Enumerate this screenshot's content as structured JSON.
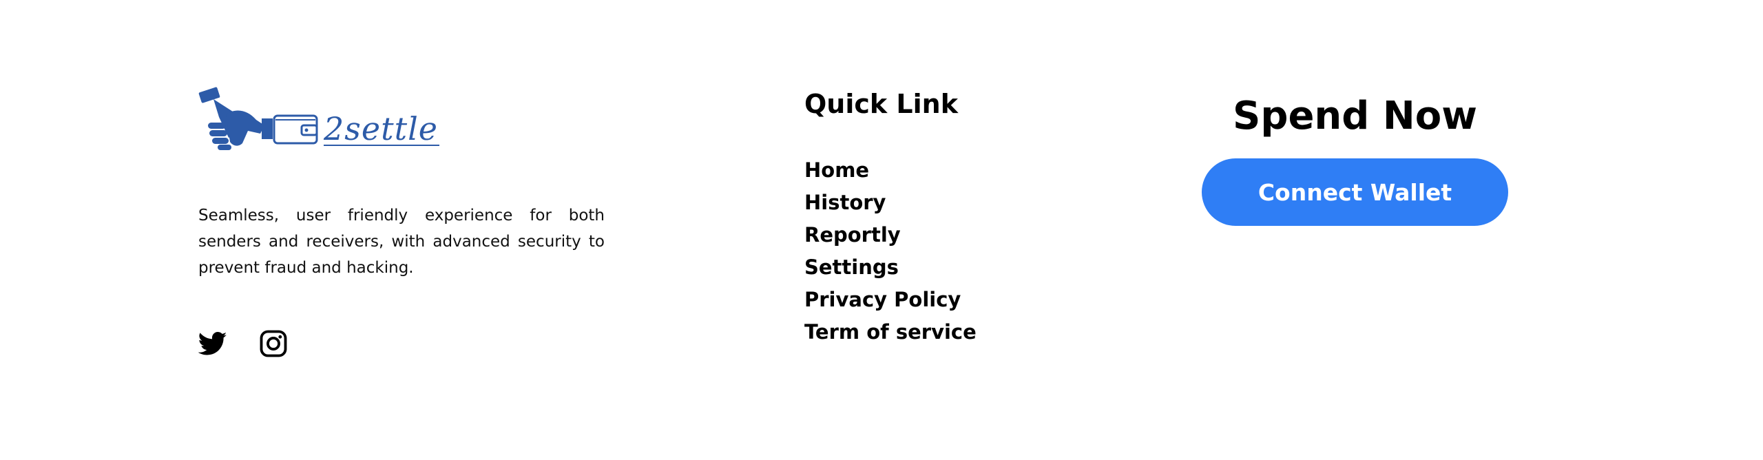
{
  "brand": {
    "name": "2settle",
    "description": "Seamless, user friendly experience for both senders and receivers, with advanced security to prevent fraud and hacking.",
    "logo_color": "#2d5ba8",
    "social_icons": [
      "twitter-icon",
      "instagram-icon"
    ]
  },
  "quick_links": {
    "title": "Quick Link",
    "items": [
      {
        "label": "Home"
      },
      {
        "label": "History"
      },
      {
        "label": "Reportly"
      },
      {
        "label": "Settings"
      },
      {
        "label": "Privacy Policy"
      },
      {
        "label": "Term of service"
      }
    ]
  },
  "cta": {
    "title": "Spend Now",
    "button_label": "Connect Wallet",
    "button_color": "#2f7ef5"
  }
}
